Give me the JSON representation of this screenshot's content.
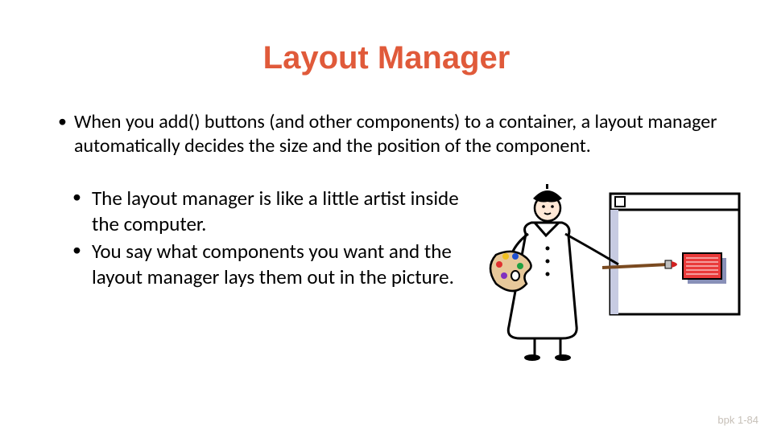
{
  "title": "Layout Manager",
  "bullets": {
    "top": "When you add() buttons (and other components) to a container, a layout manager automatically decides the size and the position of the component.",
    "left1": "The layout manager is like a little artist inside the computer.",
    "left2": "You say what components you want and the layout manager lays them out in the picture."
  },
  "footer": "bpk 1-84",
  "icons": {
    "artist": "artist-icon",
    "canvas": "canvas-window-icon",
    "palette": "palette-icon",
    "brush": "paintbrush-icon",
    "button_glyph": "button-rect-icon"
  },
  "colors": {
    "accent": "#e05a3a",
    "button_fill": "#e93a3a",
    "button_shadow": "#8890b8",
    "canvas_trim": "#9aa0c8"
  }
}
